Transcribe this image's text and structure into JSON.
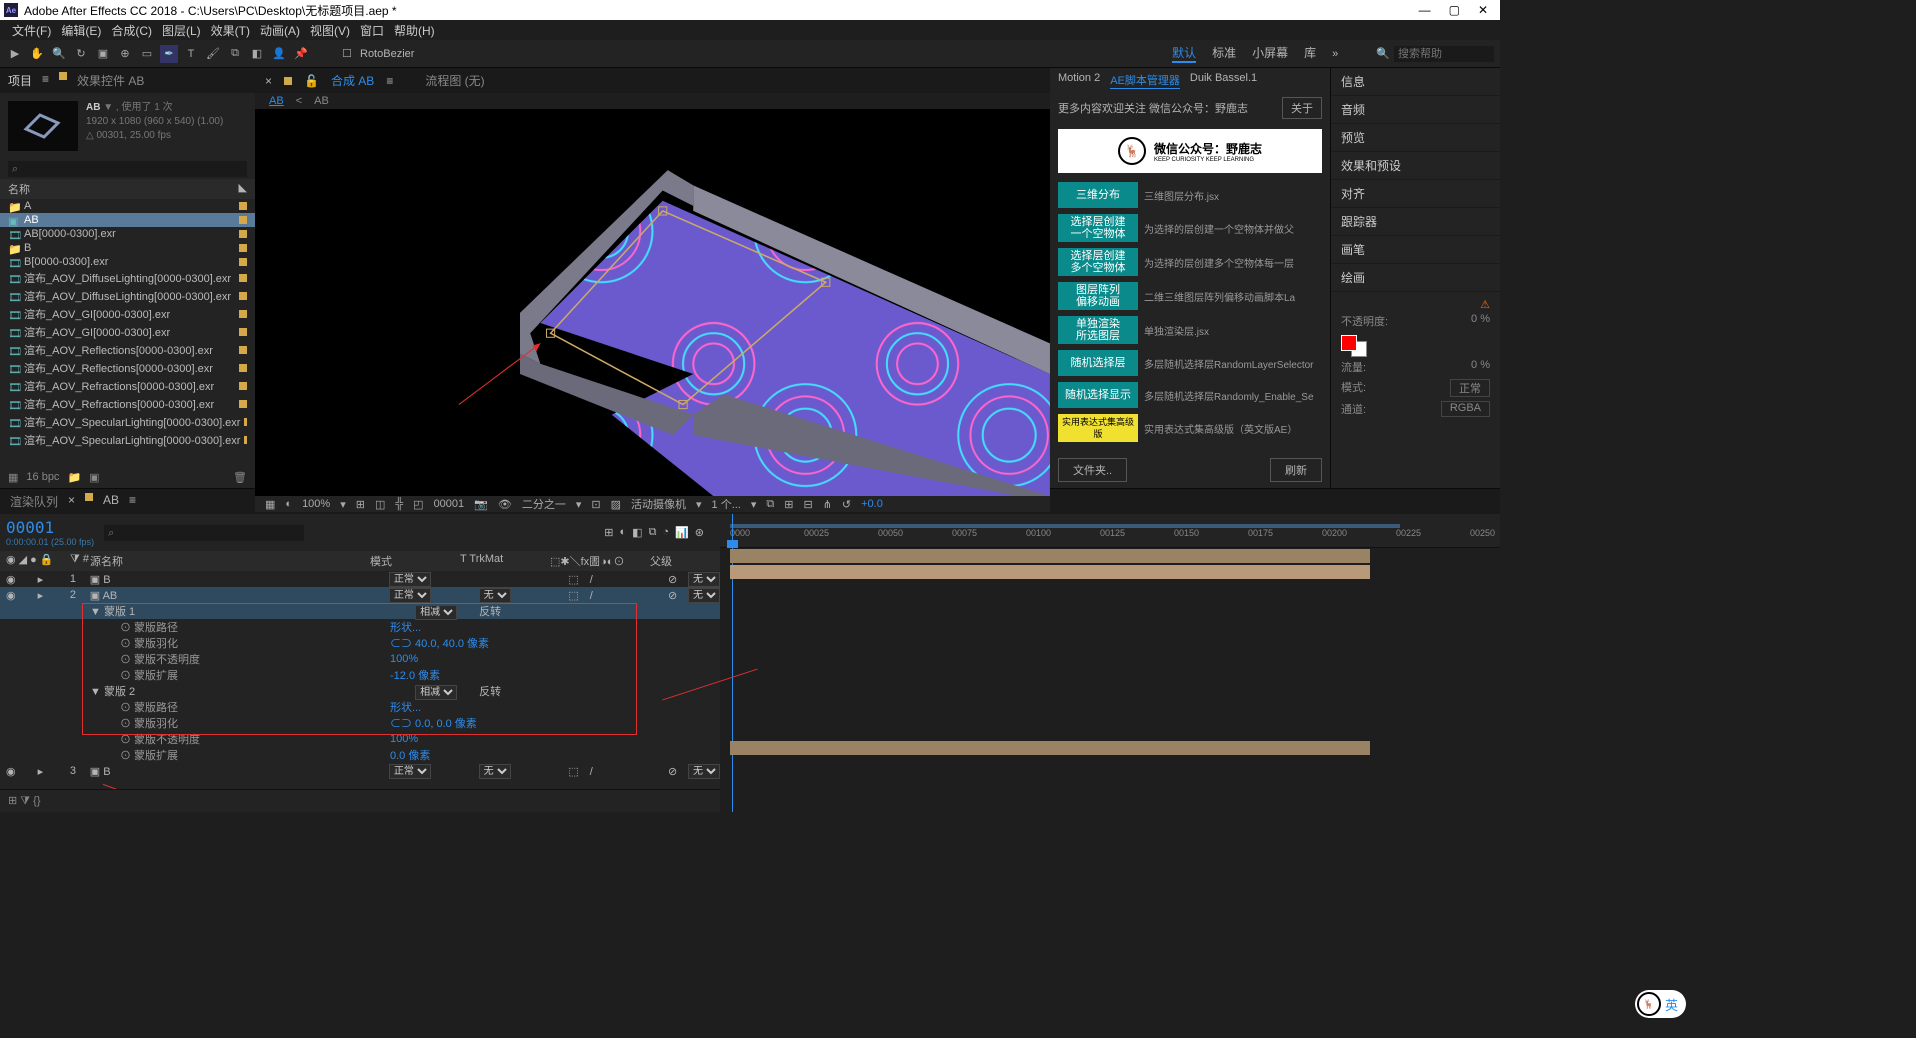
{
  "title": "Adobe After Effects CC 2018 - C:\\Users\\PC\\Desktop\\无标题项目.aep *",
  "menu": [
    "文件(F)",
    "编辑(E)",
    "合成(C)",
    "图层(L)",
    "效果(T)",
    "动画(A)",
    "视图(V)",
    "窗口",
    "帮助(H)"
  ],
  "rotobezier": "RotoBezier",
  "workspaces": {
    "active": "默认",
    "items": [
      "默认",
      "标准",
      "小屏幕",
      "库"
    ]
  },
  "search_placeholder": "搜索帮助",
  "project": {
    "tab_project": "项目",
    "tab_effects": "效果控件 AB",
    "comp_name": "AB",
    "used": "▼ , 使用了 1 次",
    "res": "1920 x 1080 (960 x 540) (1.00)",
    "dur": "△ 00301, 25.00 fps",
    "header": "名称",
    "items": [
      {
        "t": "folder",
        "n": "A"
      },
      {
        "t": "comp",
        "n": "AB",
        "sel": true
      },
      {
        "t": "seq",
        "n": "AB[0000-0300].exr"
      },
      {
        "t": "folder",
        "n": "B"
      },
      {
        "t": "seq",
        "n": "B[0000-0300].exr"
      },
      {
        "t": "seq",
        "n": "渲布_AOV_DiffuseLighting[0000-0300].exr"
      },
      {
        "t": "seq",
        "n": "渲布_AOV_DiffuseLighting[0000-0300].exr"
      },
      {
        "t": "seq",
        "n": "渲布_AOV_GI[0000-0300].exr"
      },
      {
        "t": "seq",
        "n": "渲布_AOV_GI[0000-0300].exr"
      },
      {
        "t": "seq",
        "n": "渲布_AOV_Reflections[0000-0300].exr"
      },
      {
        "t": "seq",
        "n": "渲布_AOV_Reflections[0000-0300].exr"
      },
      {
        "t": "seq",
        "n": "渲布_AOV_Refractions[0000-0300].exr"
      },
      {
        "t": "seq",
        "n": "渲布_AOV_Refractions[0000-0300].exr"
      },
      {
        "t": "seq",
        "n": "渲布_AOV_SpecularLighting[0000-0300].exr"
      },
      {
        "t": "seq",
        "n": "渲布_AOV_SpecularLighting[0000-0300].exr"
      }
    ],
    "bpc": "16 bpc"
  },
  "comp": {
    "tab_comp": "合成 AB",
    "tab_flow": "流程图 (无)",
    "sub_active": "AB",
    "sub_other": "AB",
    "zoom": "100%",
    "frame": "00001",
    "half": "二分之一",
    "camera": "活动摄像机",
    "views": "1 个...",
    "exposure": "+0.0"
  },
  "scripts": {
    "tabs": [
      "Motion 2",
      "AE脚本管理器",
      "Duik Bassel.1"
    ],
    "more": "更多内容欢迎关注 微信公众号：野鹿志",
    "about": "关于",
    "banner": "微信公众号：野鹿志",
    "banner_sub": "KEEP CURIOSITY KEEP LEARNING",
    "items": [
      {
        "btn": "三维分布",
        "desc": "三维图层分布.jsx"
      },
      {
        "btn": "选择层创建\n一个空物体",
        "desc": "为选择的层创建一个空物体并做父"
      },
      {
        "btn": "选择层创建\n多个空物体",
        "desc": "为选择的层创建多个空物体每一层"
      },
      {
        "btn": "图层阵列\n偏移动画",
        "desc": "二维三维图层阵列偏移动画脚本La"
      },
      {
        "btn": "单独渲染\n所选图层",
        "desc": "单独渲染层.jsx"
      },
      {
        "btn": "随机选择层",
        "desc": "多层随机选择层RandomLayerSelector"
      },
      {
        "btn": "随机选择显示",
        "desc": "多层随机选择层Randomly_Enable_Se"
      },
      {
        "btn": "实用表达式集高级版",
        "desc": "实用表达式集高级版（英文版AE）",
        "yellow": true
      }
    ],
    "folder": "文件夹..",
    "refresh": "刷新"
  },
  "info_panels": [
    "信息",
    "音频",
    "预览",
    "效果和预设",
    "对齐",
    "跟踪器",
    "画笔",
    "绘画"
  ],
  "paint": {
    "opacity_label": "不透明度:",
    "opacity": "0 %",
    "flow_label": "流量:",
    "flow": "0 %",
    "mode_label": "模式:",
    "mode": "正常",
    "channel_label": "通道:",
    "channel": "RGBA"
  },
  "timeline": {
    "tab_rq": "渲染队列",
    "tab_comp": "AB",
    "timecode": "00001",
    "timecode_sub": "0:00:00.01 (25.00 fps)",
    "cols": {
      "source": "源名称",
      "mode": "模式",
      "trkmat": "T   TrkMat",
      "switches": "⬚✱＼fx圕◑◐⊙",
      "parent": "父级"
    },
    "layers": [
      {
        "num": "1",
        "name": "B",
        "mode": "正常",
        "parent": "无"
      },
      {
        "num": "2",
        "name": "AB",
        "mode": "正常",
        "trkmat": "无",
        "parent": "无",
        "sel": true
      }
    ],
    "mask1": {
      "title": "蒙版 1",
      "mode": "相减",
      "invert": "反转",
      "p1": "蒙版路径",
      "v1": "形状...",
      "p2": "蒙版羽化",
      "v2": "⊂⊃ 40.0, 40.0 像素",
      "p3": "蒙版不透明度",
      "v3": "100%",
      "p4": "蒙版扩展",
      "v4": "-12.0 像素"
    },
    "mask2": {
      "title": "蒙版 2",
      "mode": "相减",
      "invert": "反转",
      "p1": "蒙版路径",
      "v1": "形状...",
      "p2": "蒙版羽化",
      "v2": "⊂⊃ 0.0, 0.0 像素",
      "p3": "蒙版不透明度",
      "v3": "100%",
      "p4": "蒙版扩展",
      "v4": "0.0 像素"
    },
    "layer3": {
      "num": "3",
      "name": "B",
      "mode": "正常",
      "trkmat": "无",
      "parent": "无"
    },
    "ruler": [
      "0000",
      "00025",
      "00050",
      "00075",
      "00100",
      "00125",
      "00150",
      "00175",
      "00200",
      "00225",
      "00250"
    ]
  },
  "ime": "英"
}
